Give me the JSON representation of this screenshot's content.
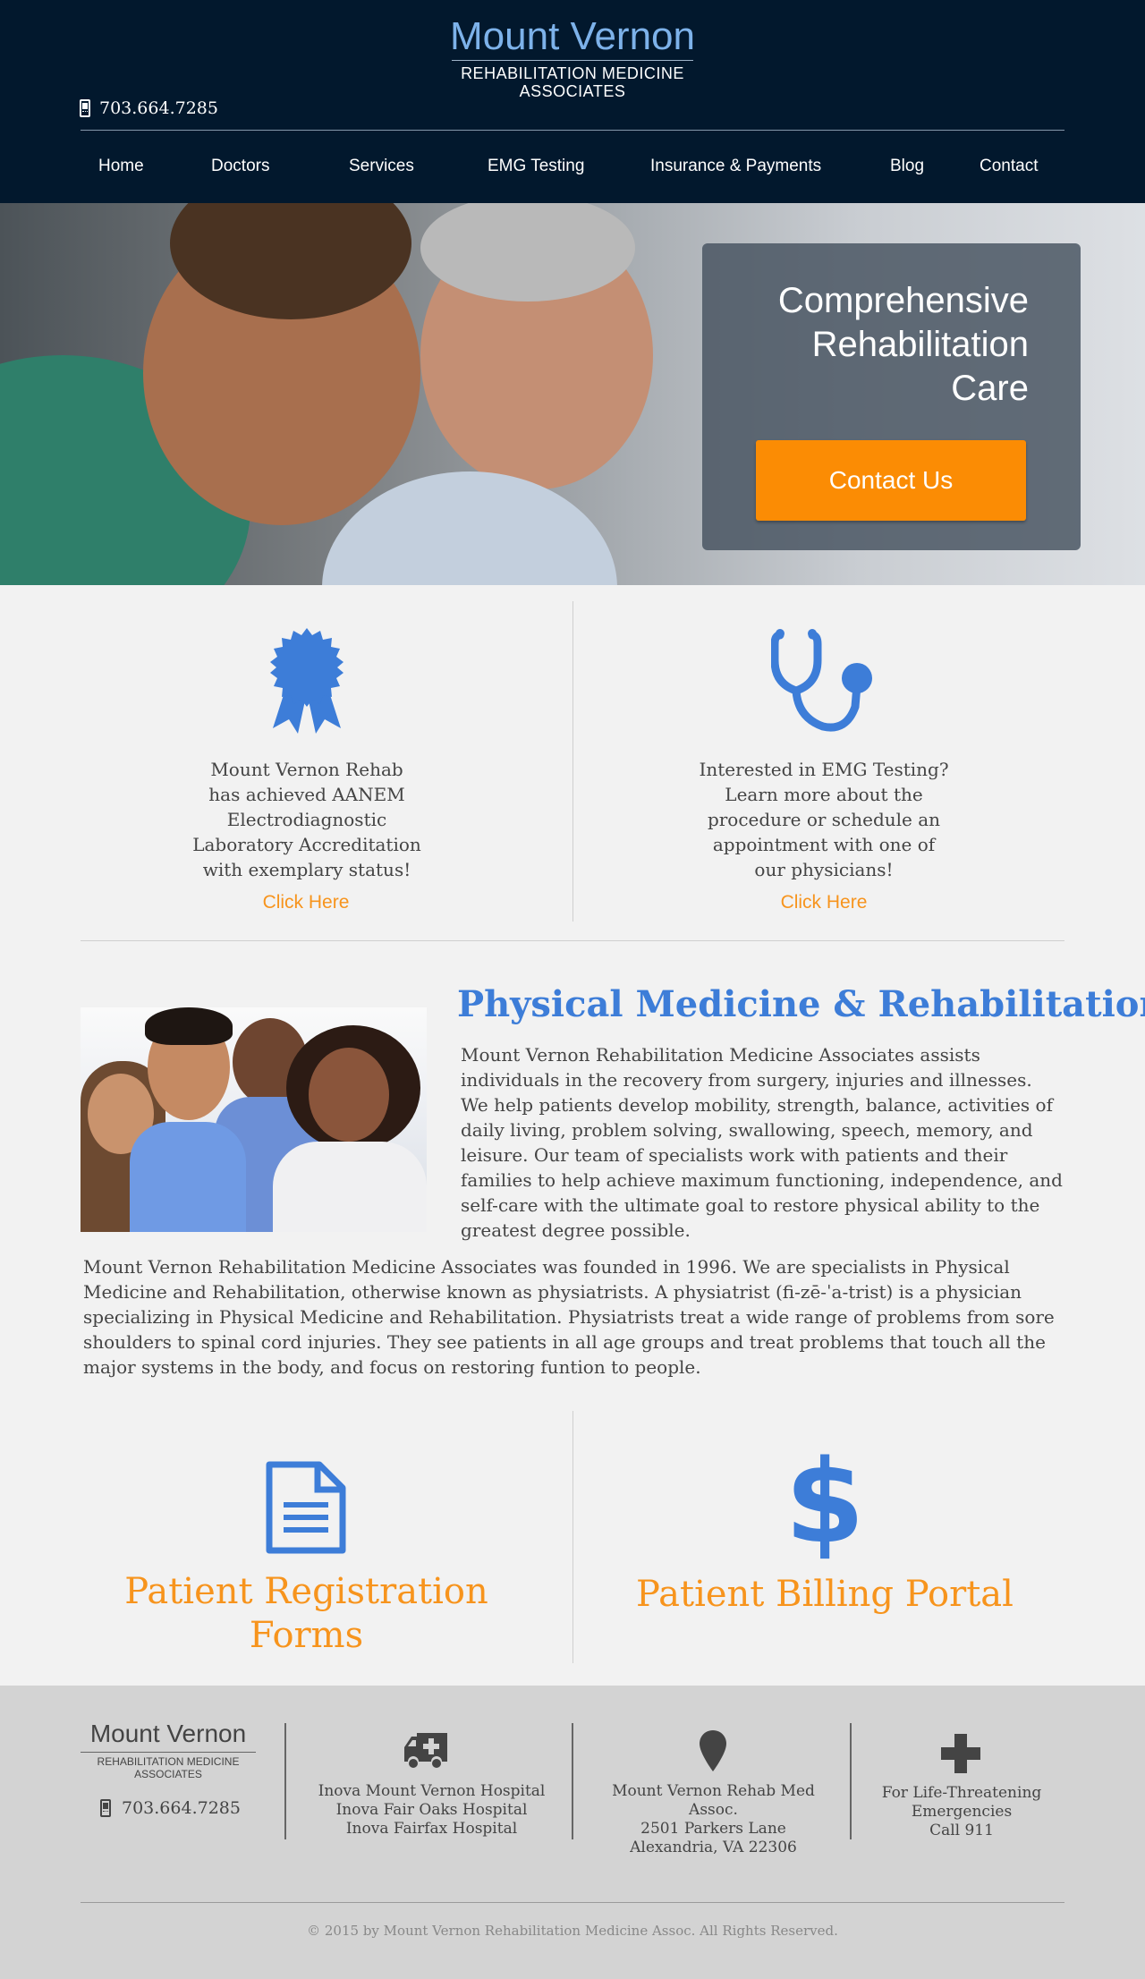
{
  "header": {
    "logo_title": "Mount Vernon",
    "logo_subtitle_line1": "REHABILITATION MEDICINE",
    "logo_subtitle_line2": "ASSOCIATES",
    "phone": "703.664.7285"
  },
  "nav": {
    "items": [
      {
        "label": "Home"
      },
      {
        "label": "Doctors"
      },
      {
        "label": "Services"
      },
      {
        "label": "EMG Testing"
      },
      {
        "label": "Insurance & Payments"
      },
      {
        "label": "Blog"
      },
      {
        "label": "Contact"
      }
    ]
  },
  "hero": {
    "title_line1": "Comprehensive",
    "title_line2": "Rehabilitation",
    "title_line3": "Care",
    "button_label": "Contact Us"
  },
  "features": [
    {
      "icon": "ribbon-award-icon",
      "lines": [
        "Mount Vernon Rehab",
        "has achieved AANEM",
        "Electrodiagnostic",
        "Laboratory Accreditation",
        "with exemplary status!"
      ],
      "link_label": "Click Here"
    },
    {
      "icon": "stethoscope-icon",
      "lines": [
        "Interested in EMG Testing?",
        "Learn more about the",
        "procedure or schedule an",
        "appointment with one of",
        "our physicians!"
      ],
      "link_label": "Click Here"
    }
  ],
  "about": {
    "title": "Physical Medicine & Rehabilitation",
    "paragraph1": "Mount Vernon Rehabilitation Medicine Associates assists individuals in the recovery from surgery, injuries and illnesses. We help patients develop mobility, strength, balance, activities of daily living, problem solving, swallowing, speech, memory, and leisure. Our team of specialists work with patients and their families to help achieve maximum functioning, independence, and self-care with the ultimate goal to restore physical ability to the greatest degree possible.",
    "paragraph2": "Mount Vernon Rehabilitation Medicine Associates was founded in 1996. We are specialists in Physical Medicine and Rehabilitation, otherwise known as physiatrists. A physiatrist (fi-zē-ˈa-trist) is a physician specializing in Physical Medicine and Rehabilitation. Physiatrists treat a wide range of problems from sore shoulders to spinal cord injuries. They see patients in all age groups and treat problems that touch all the major systems in the body, and focus on restoring funtion to people."
  },
  "patient_links": {
    "registration_line1": "Patient Registration",
    "registration_line2": "Forms",
    "billing": "Patient Billing Portal"
  },
  "footer": {
    "logo_title": "Mount Vernon",
    "logo_subtitle_line1": "REHABILITATION MEDICINE",
    "logo_subtitle_line2": "ASSOCIATES",
    "phone": "703.664.7285",
    "hospitals": [
      "Inova Mount Vernon Hospital",
      "Inova Fair Oaks Hospital",
      "Inova Fairfax Hospital"
    ],
    "address": [
      "Mount Vernon Rehab Med Assoc.",
      "2501 Parkers Lane",
      "Alexandria, VA 22306"
    ],
    "emergency": [
      "For Life-Threatening",
      "Emergencies",
      "Call 911"
    ],
    "copyright": "© 2015 by Mount Vernon Rehabilitation Medicine Assoc. All Rights Reserved."
  },
  "colors": {
    "header_bg": "#02182d",
    "accent_blue": "#3d7dd8",
    "accent_orange": "#f7941d",
    "button_orange": "#fb8c04",
    "footer_bg": "#d3d3d3"
  }
}
